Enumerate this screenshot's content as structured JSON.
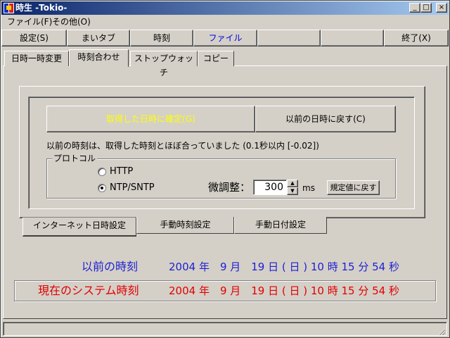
{
  "window": {
    "title": "時生 -Tokio-",
    "caption_buttons": {
      "minimize": "_",
      "maximize": "□",
      "close": "×"
    }
  },
  "menu": {
    "items": [
      {
        "label": "ファイル(F)"
      },
      {
        "label": "その他(O)"
      }
    ]
  },
  "toolbar": {
    "settings": "設定(S)",
    "maitab": "まいタブ",
    "time": "時刻",
    "file": "ファイル",
    "exit": "終了(X)"
  },
  "tabs": {
    "change": "日時一時変更",
    "adjust": "時刻合わせ",
    "stopwatch": "ストップウォッチ",
    "copy": "コピー"
  },
  "sync": {
    "confirm_button": "取得した日時に確定(G)",
    "revert_button": "以前の日時に戻す(C)",
    "status_text": "以前の時刻は、取得した時刻とほぼ合っていました (0.1秒以内 [-0.02])",
    "protocol": {
      "legend": "プロトコル",
      "http_label": "HTTP",
      "ntp_label": "NTP/SNTP",
      "selected": "NTP/SNTP"
    },
    "fine_tune": {
      "label": "微調整：",
      "value": "300",
      "unit": "ms",
      "default_button": "規定値に戻す"
    }
  },
  "bottom_tabs": {
    "internet": "インターネット日時設定",
    "manual_time": "手動時刻設定",
    "manual_date": "手動日付設定"
  },
  "times": {
    "previous": {
      "label": "以前の時刻",
      "value": "2004 年　9 月　19 日 ( 日 ) 10 時 15 分 54 秒"
    },
    "system": {
      "label": "現在のシステム時刻",
      "value": "2004 年　9 月　19 日 ( 日 ) 10 時 15 分 54 秒"
    }
  },
  "colors": {
    "title_gradient_start": "#0a246a",
    "title_gradient_end": "#a6caf0",
    "face": "#d4d0c8",
    "previous_time": "#1f1fd0",
    "system_time": "#e00000",
    "confirm_text": "#ffff00",
    "file_text": "#0000e0"
  }
}
